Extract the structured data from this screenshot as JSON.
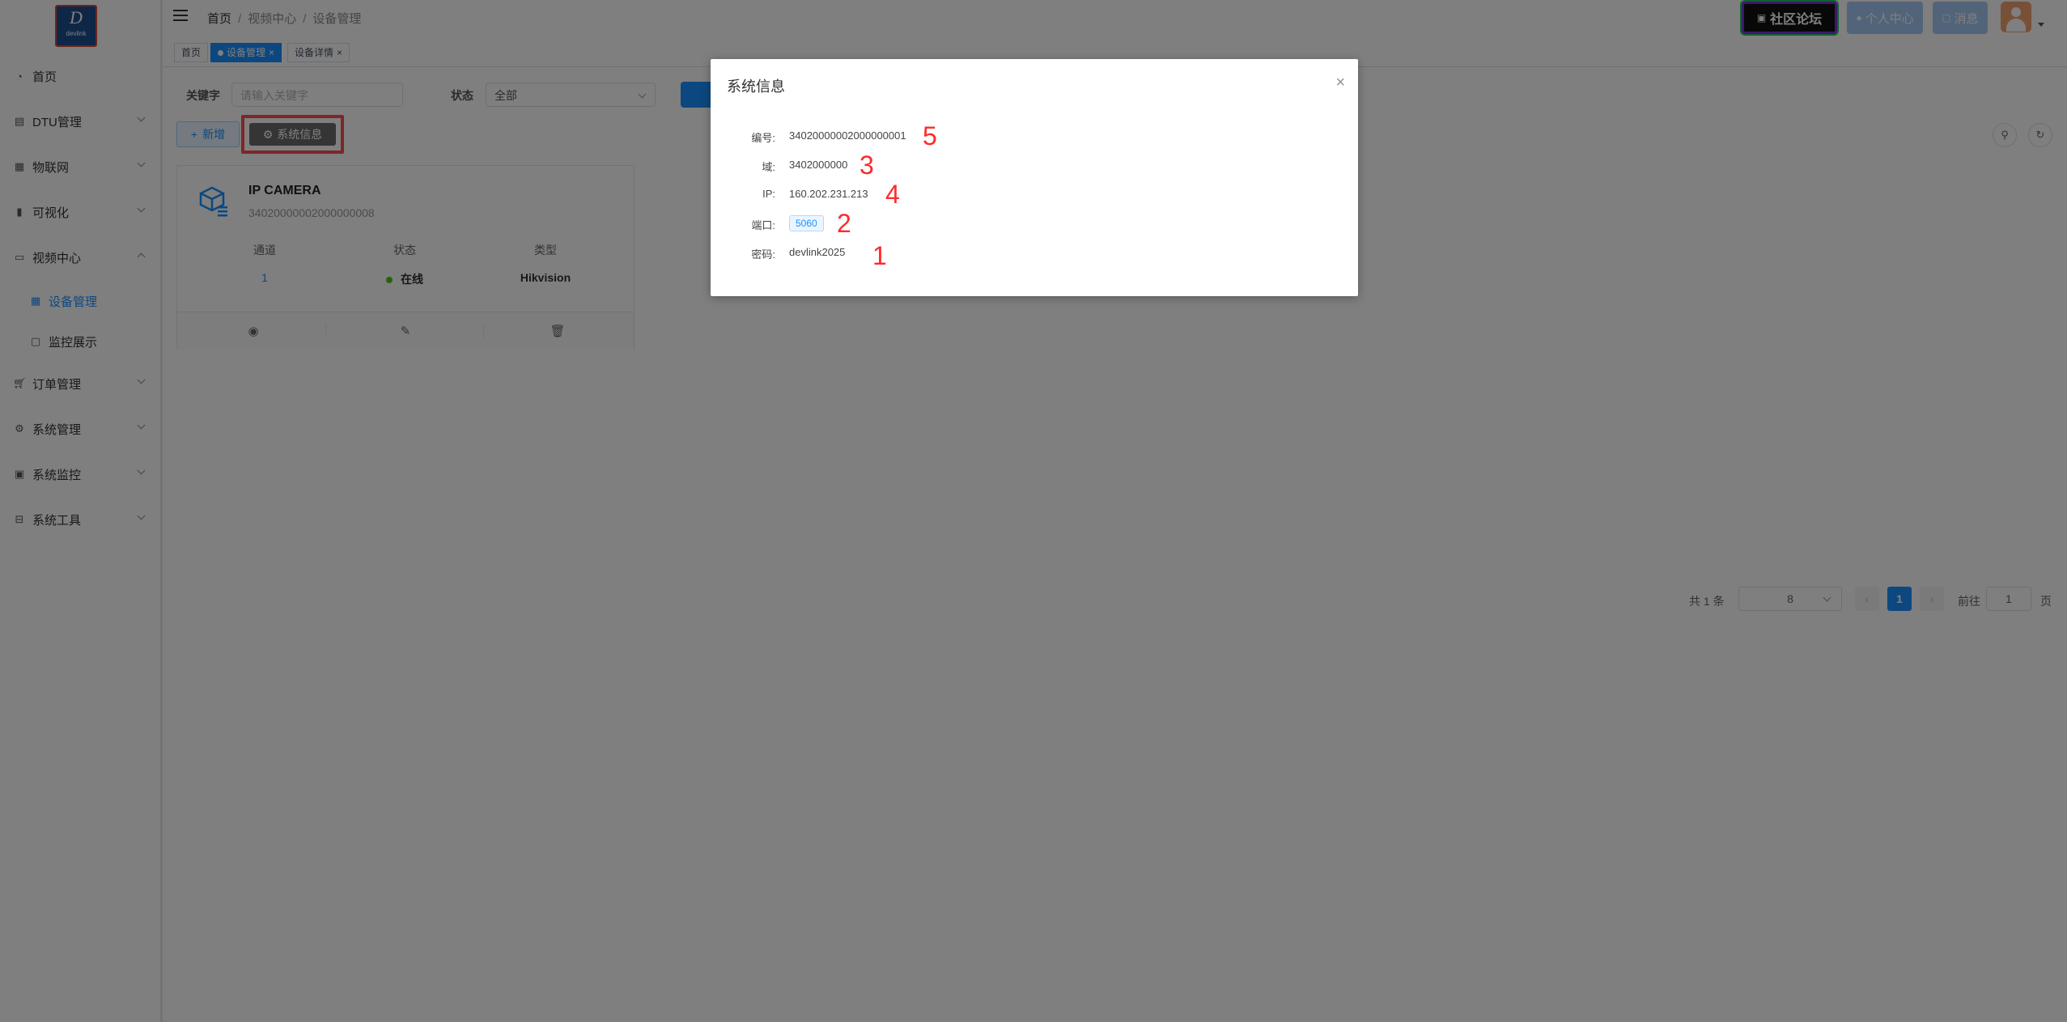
{
  "app": {
    "logo_main": "D",
    "logo_sub": "devlink"
  },
  "sidebar": {
    "items": [
      {
        "label": "首页",
        "icon": "dashboard-icon"
      },
      {
        "label": "DTU管理",
        "icon": "server-icon"
      },
      {
        "label": "物联网",
        "icon": "iot-icon"
      },
      {
        "label": "可视化",
        "icon": "chart-icon"
      },
      {
        "label": "视频中心",
        "icon": "monitor-icon"
      },
      {
        "label": "设备管理",
        "icon": "grid-icon"
      },
      {
        "label": "监控展示",
        "icon": "display-icon"
      },
      {
        "label": "订单管理",
        "icon": "cart-icon"
      },
      {
        "label": "系统管理",
        "icon": "gear-icon"
      },
      {
        "label": "系统监控",
        "icon": "screen-icon"
      },
      {
        "label": "系统工具",
        "icon": "toolbox-icon"
      }
    ]
  },
  "header": {
    "breadcrumb": [
      "首页",
      "视频中心",
      "设备管理"
    ],
    "forum_label": "社区论坛",
    "personal_label": "个人中心",
    "message_label": "消息"
  },
  "tags": [
    {
      "label": "首页"
    },
    {
      "label": "设备管理"
    },
    {
      "label": "设备详情"
    }
  ],
  "filters": {
    "keyword_label": "关键字",
    "keyword_placeholder": "请输入关键字",
    "status_label": "状态",
    "status_value": "全部"
  },
  "toolbar": {
    "add_label": "新增",
    "sysinfo_label": "系统信息"
  },
  "device": {
    "name": "IP CAMERA",
    "id": "34020000002000000008",
    "col_channel": "通道",
    "col_status": "状态",
    "col_type": "类型",
    "channel": "1",
    "status": "在线",
    "type": "Hikvision"
  },
  "pagination": {
    "total_text": "共 1 条",
    "page_size": "8",
    "current_page": "1",
    "goto_label": "前往",
    "goto_value": "1",
    "page_unit": "页",
    "prev": "‹",
    "next": "›"
  },
  "dialog": {
    "title": "系统信息",
    "close": "×",
    "rows": [
      {
        "label": "编号:",
        "value": "34020000002000000001",
        "annotation": "5"
      },
      {
        "label": "域:",
        "value": "3402000000",
        "annotation": "3"
      },
      {
        "label": "IP:",
        "value": "160.202.231.213",
        "annotation": "4"
      },
      {
        "label": "端口:",
        "value": "5060",
        "annotation": "2"
      },
      {
        "label": "密码:",
        "value": "devlink2025",
        "annotation": "1"
      }
    ]
  },
  "colors": {
    "primary": "#1890ff",
    "online": "#52c41a",
    "highlight": "#ff4d4d",
    "annotation": "#ff2a2a"
  }
}
